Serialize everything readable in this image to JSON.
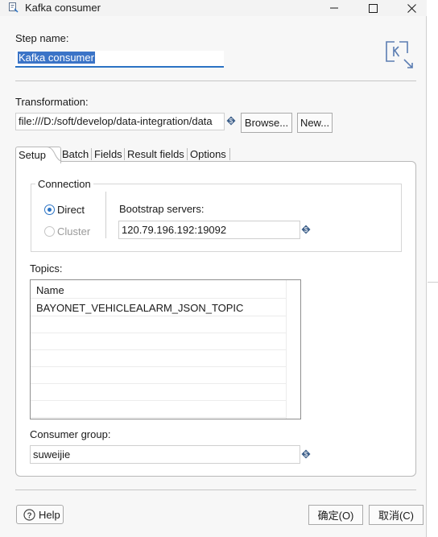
{
  "window": {
    "title": "Kafka consumer",
    "icon": "kettle-step-icon"
  },
  "step_name": {
    "label": "Step name:",
    "value": "Kafka consumer",
    "badge_icon": "kafka-k-logo-icon"
  },
  "transformation": {
    "label": "Transformation:",
    "path": "file:///D:/soft/develop/data-integration/data",
    "browse_label": "Browse...",
    "new_label": "New..."
  },
  "tabs": [
    {
      "label": "Setup",
      "active": true
    },
    {
      "label": "Batch",
      "active": false
    },
    {
      "label": "Fields",
      "active": false
    },
    {
      "label": "Result fields",
      "active": false
    },
    {
      "label": "Options",
      "active": false
    }
  ],
  "connection": {
    "title": "Connection",
    "options": [
      {
        "label": "Direct",
        "selected": true,
        "enabled": true
      },
      {
        "label": "Cluster",
        "selected": false,
        "enabled": false
      }
    ],
    "bootstrap_label": "Bootstrap servers:",
    "bootstrap_value": "120.79.196.192:19092"
  },
  "topics": {
    "label": "Topics:",
    "columns": [
      "Name"
    ],
    "rows": [
      [
        "BAYONET_VEHICLEALARM_JSON_TOPIC"
      ]
    ]
  },
  "consumer_group": {
    "label": "Consumer group:",
    "value": "suweijie"
  },
  "footer": {
    "help_label": "Help",
    "ok_label": "确定(O)",
    "cancel_label": "取消(C)"
  },
  "colors": {
    "accent": "#2b73c4",
    "selection": "#3b74c7",
    "variable_icon": "#3d5f8a"
  }
}
